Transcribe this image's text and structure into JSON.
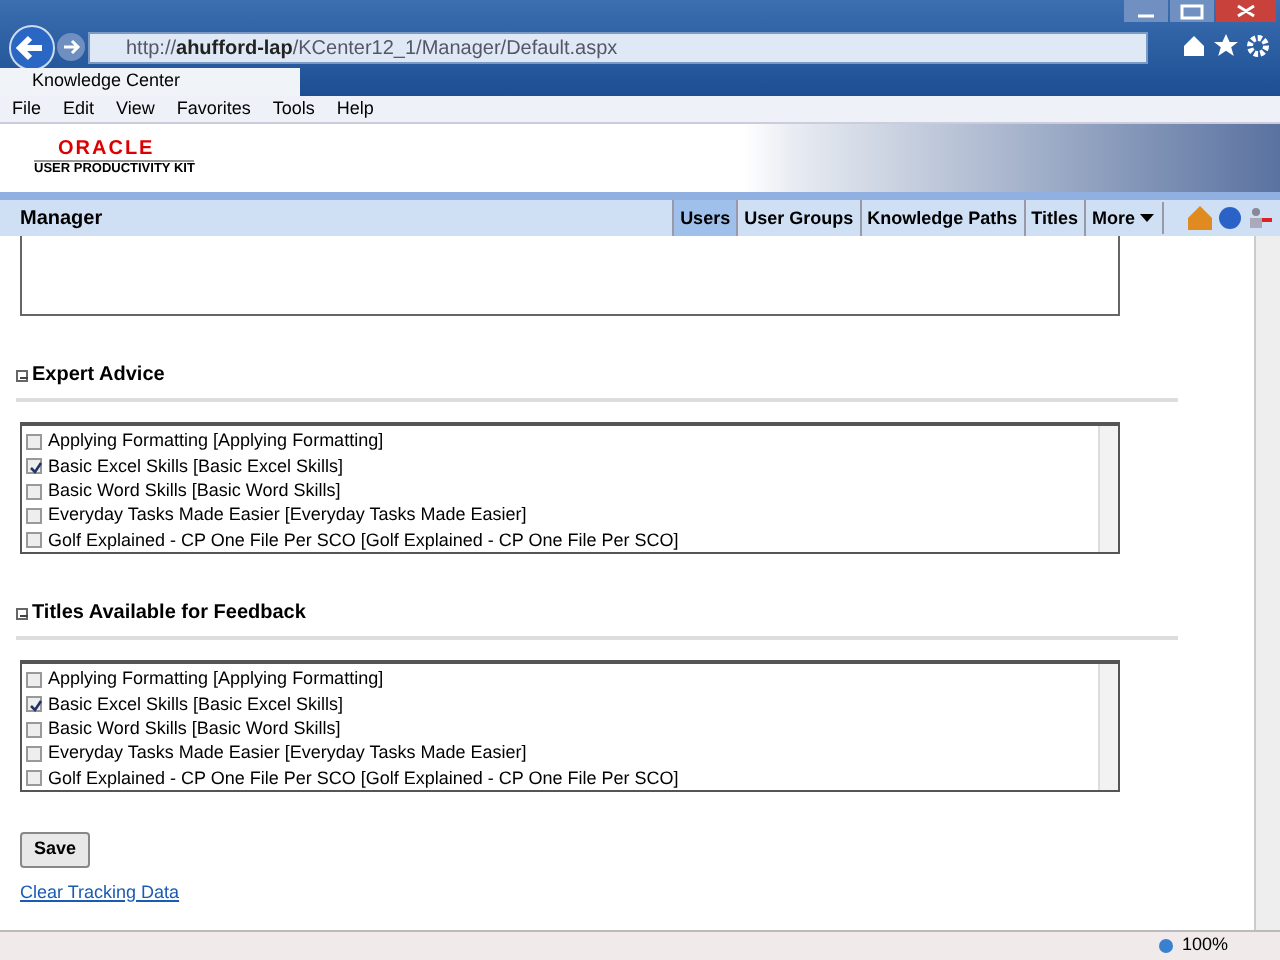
{
  "browser": {
    "url": "http://**ahufford-lap**/KCenter12_1/Manager/Default.aspx",
    "tab_title": "Knowledge Center",
    "menu": [
      "File",
      "Edit",
      "View",
      "Favorites",
      "Tools",
      "Help"
    ]
  },
  "logo": {
    "brand": "ORACLE",
    "product": "USER PRODUCTIVITY KIT"
  },
  "navbar": {
    "title": "Manager",
    "tabs": [
      {
        "label": "Users",
        "selected": true,
        "kind": "link"
      },
      {
        "label": "User Groups",
        "selected": false,
        "kind": "link"
      },
      {
        "label": "Knowledge Paths",
        "selected": false,
        "kind": "link"
      },
      {
        "label": "Titles",
        "selected": false,
        "kind": "link"
      },
      {
        "label": "More",
        "selected": false,
        "kind": "menu"
      }
    ]
  },
  "sections": [
    {
      "title": "Expert Advice",
      "expanded": true,
      "items": [
        {
          "label": "Applying Formatting [Applying Formatting]",
          "checked": false
        },
        {
          "label": "Basic Excel Skills [Basic Excel Skills]",
          "checked": true
        },
        {
          "label": "Basic Word Skills [Basic Word Skills]",
          "checked": false
        },
        {
          "label": "Everyday Tasks Made Easier [Everyday Tasks Made Easier]",
          "checked": false
        },
        {
          "label": "Golf Explained - CP One File Per SCO [Golf Explained - CP One File Per SCO]",
          "checked": false
        }
      ]
    },
    {
      "title": "Titles Available for Feedback",
      "expanded": true,
      "items": [
        {
          "label": "Applying Formatting [Applying Formatting]",
          "checked": false
        },
        {
          "label": "Basic Excel Skills [Basic Excel Skills]",
          "checked": true
        },
        {
          "label": "Basic Word Skills [Basic Word Skills]",
          "checked": false
        },
        {
          "label": "Everyday Tasks Made Easier [Everyday Tasks Made Easier]",
          "checked": false
        },
        {
          "label": "Golf Explained - CP One File Per SCO [Golf Explained - CP One File Per SCO]",
          "checked": false
        }
      ]
    }
  ],
  "save_button": "Save",
  "link": "Clear Tracking Data",
  "status_bar": {
    "zoom": "100%"
  }
}
